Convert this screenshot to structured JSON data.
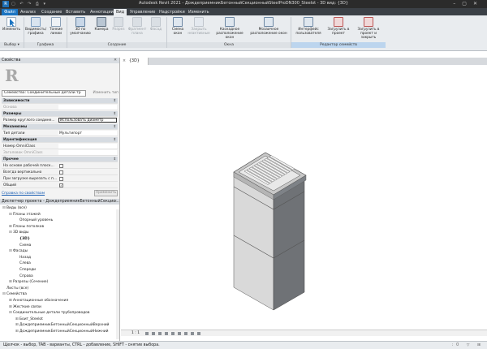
{
  "window": {
    "title": "Autodesk Revit 2021 - ДождеприемникБетонныйСекционныйSteelProDN300_Steelot - 3D вид: {3D}"
  },
  "ribbon": {
    "tabs": [
      "Файл",
      "Анализ",
      "Создание",
      "Вставить",
      "Аннотации",
      "Вид",
      "Управление",
      "Надстройки",
      "Изменить"
    ],
    "active_tab": "Вид",
    "buttons": {
      "modify": "Изменить",
      "visibility": "Видимость/ графика",
      "thin_lines": "Тонкие линии",
      "view_3d": "3D по умолчанию",
      "camera": "Камера",
      "section": "Разрез",
      "elevation": "Фрагмент плана",
      "facade": "Фасад",
      "switch_windows": "Смена окон",
      "close_inactive": "Закрыть неактивные",
      "tile": "Каскадное расположение окон",
      "mosaic": "Мозаичное расположение окон",
      "ui": "Интерфейс пользователя",
      "load_project": "Загрузить в проект",
      "load_close": "Загрузить в проект и закрыть"
    },
    "panels": {
      "select": "Выбор ▾",
      "graphics": "Графика",
      "create": "Создание",
      "windows": "Окна",
      "family_editor": "Редактор семейств"
    }
  },
  "properties": {
    "title": "Свойства",
    "type_selector": "Семейство: Соединительные детали тр",
    "edit_type": "Изменить тип",
    "rows": [
      {
        "kind": "cat",
        "label": "Зависимости"
      },
      {
        "kind": "row",
        "label": "Основа",
        "value": "",
        "dim": true
      },
      {
        "kind": "cat",
        "label": "Размеры"
      },
      {
        "kind": "row",
        "label": "Размер круглого соедине...",
        "value": "Использовать диаметр",
        "boxed": true
      },
      {
        "kind": "cat",
        "label": "Механизмы"
      },
      {
        "kind": "row",
        "label": "Тип детали",
        "value": "Мультипорт"
      },
      {
        "kind": "cat",
        "label": "Идентификация"
      },
      {
        "kind": "row",
        "label": "Номер OmniClass",
        "value": ""
      },
      {
        "kind": "row",
        "label": "Заголовок OmniClass",
        "value": "",
        "dim": true
      },
      {
        "kind": "cat",
        "label": "Прочее"
      },
      {
        "kind": "chk",
        "label": "На основе рабочей плоск...",
        "checked": false
      },
      {
        "kind": "chk",
        "label": "Всегда вертикально",
        "checked": false
      },
      {
        "kind": "chk",
        "label": "При загрузке вырезать с п...",
        "checked": false
      },
      {
        "kind": "chk",
        "label": "Общий",
        "checked": true
      }
    ],
    "help_link": "Справка по свойствам",
    "apply": "Применить"
  },
  "browser": {
    "title": "Диспетчер проекта - ДождеприемникБетонныйСекцио...",
    "nodes": [
      {
        "d": 0,
        "t": "⊟",
        "label": "Виды (все)",
        "icon": true
      },
      {
        "d": 1,
        "t": "⊟",
        "label": "Планы этажей"
      },
      {
        "d": 2,
        "t": "",
        "label": "Опорный уровень"
      },
      {
        "d": 1,
        "t": "⊞",
        "label": "Планы потолков"
      },
      {
        "d": 1,
        "t": "⊟",
        "label": "3D виды"
      },
      {
        "d": 2,
        "t": "",
        "label": "{3D}",
        "bold": true
      },
      {
        "d": 2,
        "t": "",
        "label": "Схема"
      },
      {
        "d": 1,
        "t": "⊟",
        "label": "Фасады"
      },
      {
        "d": 2,
        "t": "",
        "label": "Назад"
      },
      {
        "d": 2,
        "t": "",
        "label": "Слева"
      },
      {
        "d": 2,
        "t": "",
        "label": "Спереди"
      },
      {
        "d": 2,
        "t": "",
        "label": "Справа"
      },
      {
        "d": 1,
        "t": "⊞",
        "label": "Разрезы (Сечение)"
      },
      {
        "d": 0,
        "t": "",
        "label": "Листы (все)",
        "icon": true
      },
      {
        "d": 0,
        "t": "⊟",
        "label": "Семейства",
        "icon": true
      },
      {
        "d": 1,
        "t": "⊞",
        "label": "Аннотационные обозначения"
      },
      {
        "d": 1,
        "t": "⊞",
        "label": "Жесткие связи"
      },
      {
        "d": 1,
        "t": "⊟",
        "label": "Соединительные детали трубопроводов"
      },
      {
        "d": 2,
        "t": "⊞",
        "label": "Боит_Steelot"
      },
      {
        "d": 2,
        "t": "⊞",
        "label": "ДождеприемникБетонныйСекционныйВерхний"
      },
      {
        "d": 2,
        "t": "⊞",
        "label": "ДождеприемникБетонныйСекционныйНижний"
      }
    ]
  },
  "view": {
    "tab_label": "{3D}",
    "tab_close": "×",
    "scale": "1 : 1"
  },
  "status": {
    "text": "Щелчок - выбор, TAB - варианты, CTRL - добавление, SHIFT - снятие выбора.",
    "right": ":0  ▽ ⊞"
  },
  "colors": {
    "accent": "#1b74c1",
    "tab_bg": "#3b4046",
    "ribbon_bg": "#e9ecef",
    "highlight": "#bcd5ee"
  }
}
